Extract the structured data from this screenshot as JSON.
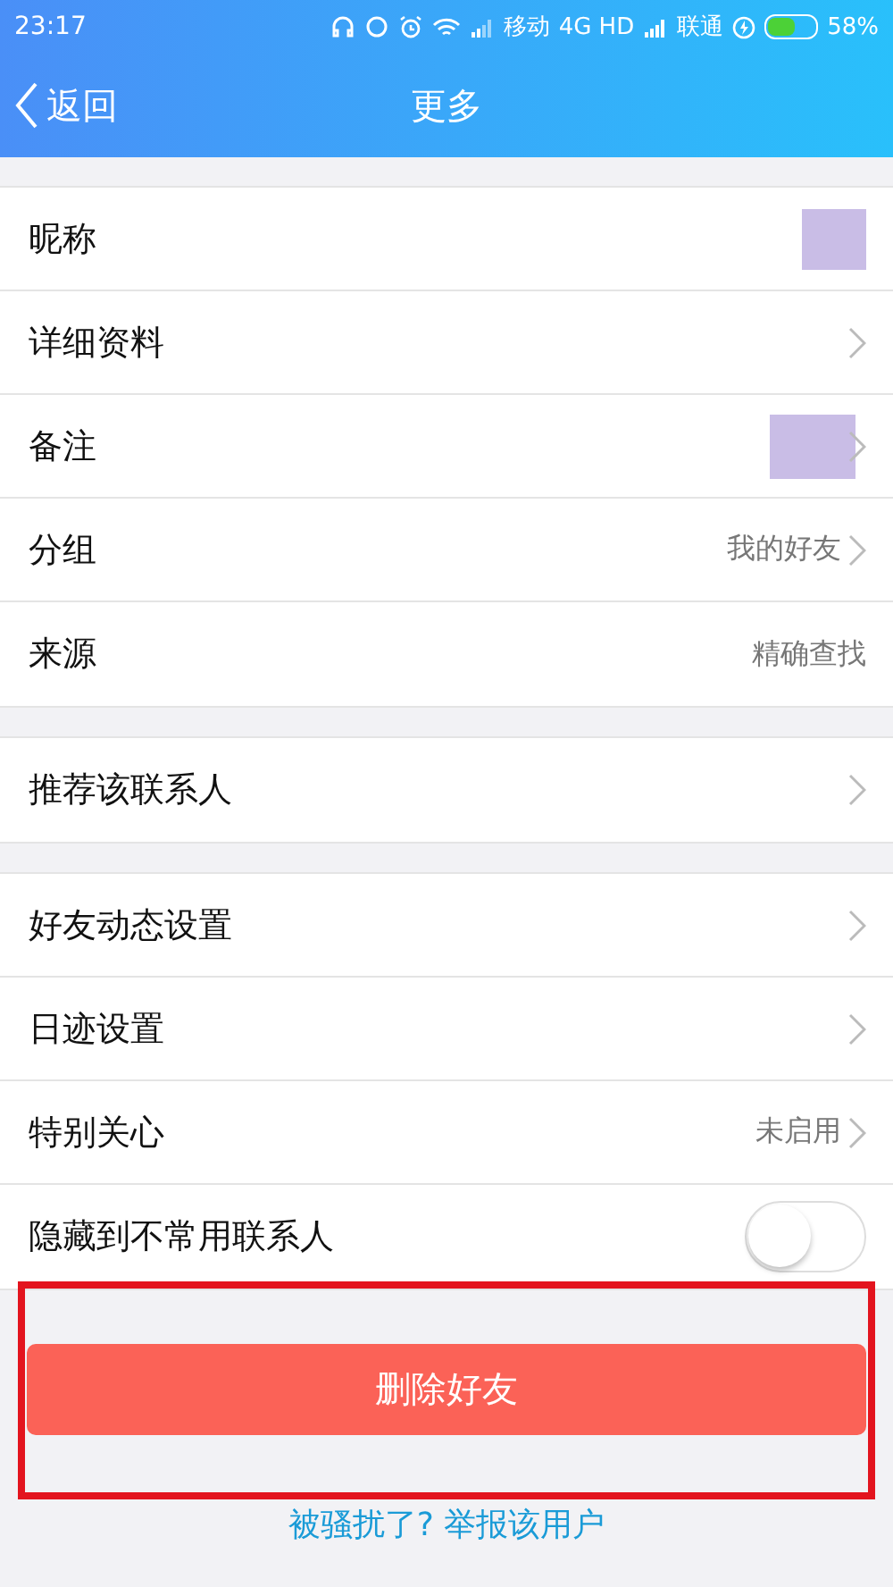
{
  "status_bar": {
    "time": "23:17",
    "carrier_1": "移动",
    "network": "4G HD",
    "carrier_2": "联通",
    "battery_text": "58%"
  },
  "nav": {
    "back": "返回",
    "title": "更多"
  },
  "groups": [
    {
      "rows": [
        {
          "kind": "redacted",
          "label": "昵称",
          "chevron": false
        },
        {
          "kind": "link",
          "label": "详细资料",
          "chevron": true
        },
        {
          "kind": "redacted",
          "label": "备注",
          "chevron": true
        },
        {
          "kind": "value",
          "label": "分组",
          "value": "我的好友",
          "chevron": true
        },
        {
          "kind": "value",
          "label": "来源",
          "value": "精确查找",
          "chevron": false
        }
      ]
    },
    {
      "rows": [
        {
          "kind": "link",
          "label": "推荐该联系人",
          "chevron": true
        }
      ]
    },
    {
      "rows": [
        {
          "kind": "link",
          "label": "好友动态设置",
          "chevron": true
        },
        {
          "kind": "link",
          "label": "日迹设置",
          "chevron": true
        },
        {
          "kind": "value",
          "label": "特别关心",
          "value": "未启用",
          "chevron": true
        },
        {
          "kind": "toggle",
          "label": "隐藏到不常用联系人",
          "on": false
        }
      ]
    }
  ],
  "delete_button": "删除好友",
  "report_link": "被骚扰了? 举报该用户"
}
